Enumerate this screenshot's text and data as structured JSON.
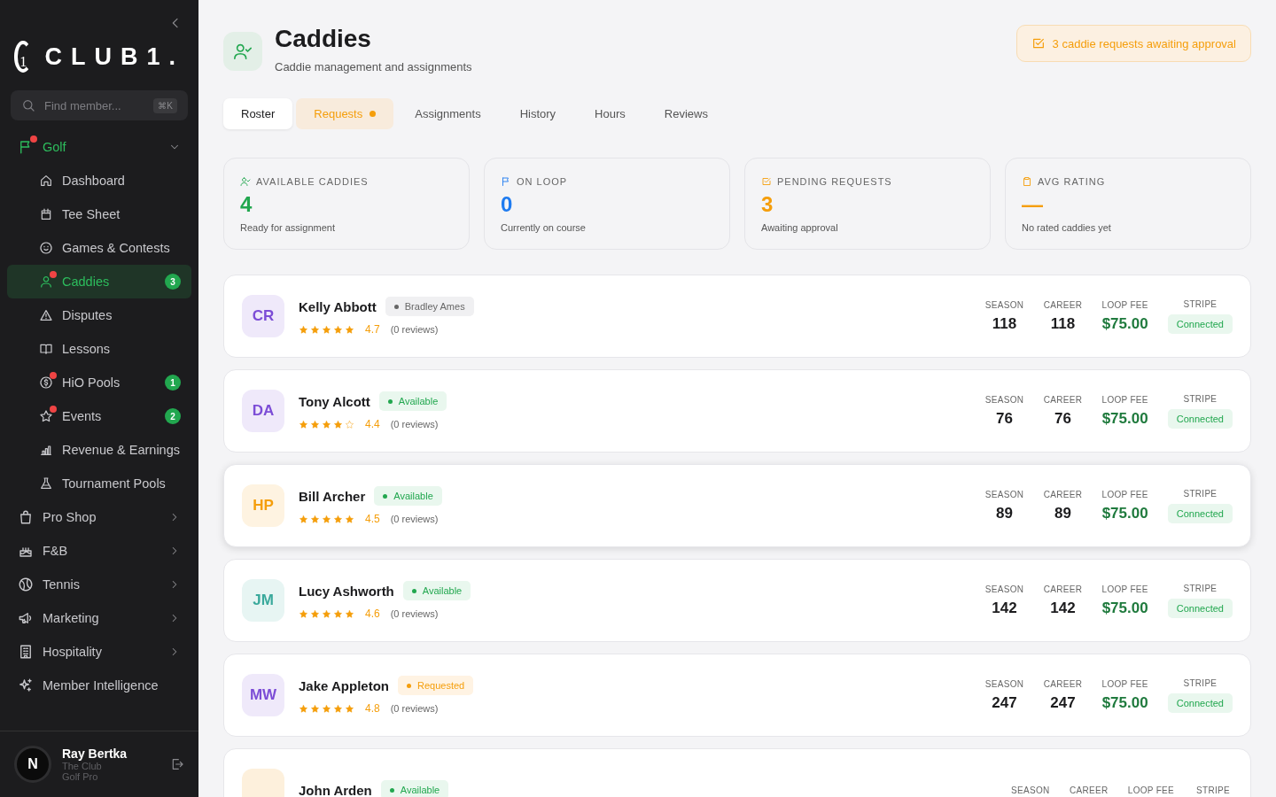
{
  "sidebar": {
    "logo": {
      "mark": "1",
      "text": "CLUB1."
    },
    "search": {
      "placeholder": "Find member...",
      "shortcut": "⌘K"
    },
    "nav": [
      {
        "label": "Golf",
        "kind": "section",
        "expanded": true,
        "dot": true,
        "children": [
          {
            "label": "Dashboard",
            "selected": false,
            "dot": false
          },
          {
            "label": "Tee Sheet",
            "selected": false,
            "dot": false
          },
          {
            "label": "Games & Contests",
            "selected": false,
            "dot": false
          },
          {
            "label": "Caddies",
            "selected": true,
            "dot": true,
            "badge": "3"
          },
          {
            "label": "Disputes",
            "selected": false,
            "dot": false
          },
          {
            "label": "Lessons",
            "selected": false,
            "dot": false
          },
          {
            "label": "HiO Pools",
            "selected": false,
            "dot": true,
            "badge": "1"
          },
          {
            "label": "Events",
            "selected": false,
            "dot": true,
            "badge": "2"
          },
          {
            "label": "Revenue & Earnings",
            "selected": false,
            "dot": false
          },
          {
            "label": "Tournament Pools",
            "selected": false,
            "dot": false
          }
        ]
      },
      {
        "label": "Pro Shop",
        "kind": "section",
        "expanded": false,
        "dot": false
      },
      {
        "label": "F&B",
        "kind": "section",
        "expanded": false,
        "dot": false
      },
      {
        "label": "Tennis",
        "kind": "section",
        "expanded": false,
        "dot": false
      },
      {
        "label": "Marketing",
        "kind": "section",
        "expanded": false,
        "dot": false
      },
      {
        "label": "Hospitality",
        "kind": "section",
        "expanded": false,
        "dot": false
      },
      {
        "label": "Member Intelligence",
        "kind": "link",
        "dot": false
      }
    ],
    "user": {
      "initial": "N",
      "name": "Ray Bertka",
      "club": "The Club",
      "role": "Golf Pro"
    }
  },
  "header": {
    "title": "Caddies",
    "subtitle": "Caddie management and assignments",
    "alert": "3 caddie requests awaiting approval"
  },
  "tabs": [
    {
      "label": "Roster",
      "selected": true,
      "attention": false
    },
    {
      "label": "Requests",
      "selected": false,
      "attention": true
    },
    {
      "label": "Assignments",
      "selected": false,
      "attention": false
    },
    {
      "label": "History",
      "selected": false,
      "attention": false
    },
    {
      "label": "Hours",
      "selected": false,
      "attention": false
    },
    {
      "label": "Reviews",
      "selected": false,
      "attention": false
    }
  ],
  "stats": [
    {
      "kind": "available",
      "label": "AVAILABLE CADDIES",
      "value": "4",
      "caption": "Ready for assignment",
      "color": "#22a74f"
    },
    {
      "kind": "on_loop",
      "label": "ON LOOP",
      "value": "0",
      "caption": "Currently on course",
      "color": "#1e7bf0"
    },
    {
      "kind": "pending",
      "label": "PENDING REQUESTS",
      "value": "3",
      "caption": "Awaiting approval",
      "color": "#f59e0b"
    },
    {
      "kind": "rating",
      "label": "AVG RATING",
      "value": "—",
      "caption": "No rated caddies yet",
      "color": "#f59e0b"
    }
  ],
  "caddies": [
    {
      "initials": "CR",
      "color": "#7c4dd6",
      "name": "Kelly Abbott",
      "status": {
        "kind": "assigned",
        "text": "Bradley Ames"
      },
      "stars": 5,
      "rating": "4.7",
      "reviews": "(0 reviews)",
      "highlighted": false,
      "stats": [
        {
          "kind": "count",
          "label": "SEASON",
          "value": "118"
        },
        {
          "kind": "count",
          "label": "CAREER",
          "value": "118"
        },
        {
          "kind": "money",
          "label": "LOOP FEE",
          "value": "$75.00"
        }
      ],
      "stripe": {
        "label": "STRIPE",
        "value": "Connected"
      }
    },
    {
      "initials": "DA",
      "color": "#7c4dd6",
      "name": "Tony Alcott",
      "status": {
        "kind": "available",
        "text": "Available"
      },
      "stars": 4,
      "rating": "4.4",
      "reviews": "(0 reviews)",
      "highlighted": false,
      "stats": [
        {
          "kind": "count",
          "label": "SEASON",
          "value": "76"
        },
        {
          "kind": "count",
          "label": "CAREER",
          "value": "76"
        },
        {
          "kind": "money",
          "label": "LOOP FEE",
          "value": "$75.00"
        }
      ],
      "stripe": {
        "label": "STRIPE",
        "value": "Connected"
      }
    },
    {
      "initials": "HP",
      "color": "#f59e0b",
      "name": "Bill Archer",
      "status": {
        "kind": "available",
        "text": "Available"
      },
      "stars": 5,
      "rating": "4.5",
      "reviews": "(0 reviews)",
      "highlighted": true,
      "stats": [
        {
          "kind": "count",
          "label": "SEASON",
          "value": "89"
        },
        {
          "kind": "count",
          "label": "CAREER",
          "value": "89"
        },
        {
          "kind": "money",
          "label": "LOOP FEE",
          "value": "$75.00"
        }
      ],
      "stripe": {
        "label": "STRIPE",
        "value": "Connected"
      }
    },
    {
      "initials": "JM",
      "color": "#3aa99c",
      "name": "Lucy Ashworth",
      "status": {
        "kind": "available",
        "text": "Available"
      },
      "stars": 5,
      "rating": "4.6",
      "reviews": "(0 reviews)",
      "highlighted": false,
      "stats": [
        {
          "kind": "count",
          "label": "SEASON",
          "value": "142"
        },
        {
          "kind": "count",
          "label": "CAREER",
          "value": "142"
        },
        {
          "kind": "money",
          "label": "LOOP FEE",
          "value": "$75.00"
        }
      ],
      "stripe": {
        "label": "STRIPE",
        "value": "Connected"
      }
    },
    {
      "initials": "MW",
      "color": "#7c4dd6",
      "name": "Jake Appleton",
      "status": {
        "kind": "requested",
        "text": "Requested"
      },
      "stars": 5,
      "rating": "4.8",
      "reviews": "(0 reviews)",
      "highlighted": false,
      "stats": [
        {
          "kind": "count",
          "label": "SEASON",
          "value": "247"
        },
        {
          "kind": "count",
          "label": "CAREER",
          "value": "247"
        },
        {
          "kind": "money",
          "label": "LOOP FEE",
          "value": "$75.00"
        }
      ],
      "stripe": {
        "label": "STRIPE",
        "value": "Connected"
      }
    },
    {
      "color": "#fdf0dc",
      "name": "John Arden",
      "status": {
        "kind": "available",
        "text": "Available"
      },
      "highlighted": false,
      "stats": [
        {
          "kind": "count",
          "label": "SEASON"
        },
        {
          "kind": "count",
          "label": "CAREER"
        },
        {
          "kind": "money",
          "label": "LOOP FEE"
        }
      ],
      "stripe": {
        "label": "STRIPE"
      }
    }
  ]
}
